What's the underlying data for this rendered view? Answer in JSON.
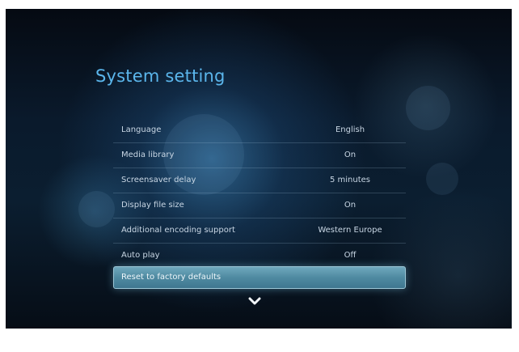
{
  "title": "System setting",
  "settings": [
    {
      "label": "Language",
      "value": "English"
    },
    {
      "label": "Media library",
      "value": "On"
    },
    {
      "label": "Screensaver delay",
      "value": "5 minutes"
    },
    {
      "label": "Display file size",
      "value": "On"
    },
    {
      "label": "Additional encoding support",
      "value": "Western Europe"
    },
    {
      "label": "Auto play",
      "value": "Off"
    }
  ],
  "reset": {
    "label": "Reset to factory defaults"
  },
  "scroll_indicator": {
    "icon": "chevron-down-icon"
  },
  "colors": {
    "title": "#5bb6ec",
    "highlight": "#5a93a8",
    "text": "#c8d6e4"
  }
}
